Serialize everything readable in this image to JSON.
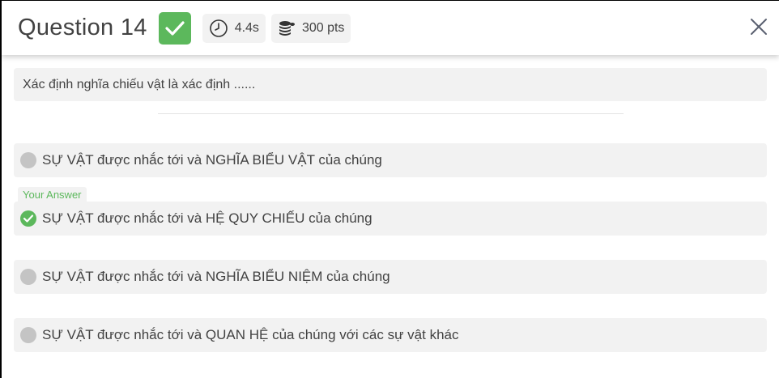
{
  "header": {
    "title": "Question 14",
    "time": "4.4s",
    "points": "300 pts",
    "status_icon": "check-icon",
    "time_icon": "clock-icon",
    "points_icon": "coins-icon",
    "close_icon": "close-icon"
  },
  "question": {
    "text": "Xác định nghĩa chiếu vật là xác định ......"
  },
  "answer_tag": "Your Answer",
  "options": [
    {
      "text": "SỰ VẬT được nhắc tới và NGHĨA BIỂU VẬT của chúng",
      "selected": false
    },
    {
      "text": "SỰ VẬT được nhắc tới và HỆ QUY CHIẾU của chúng",
      "selected": true
    },
    {
      "text": "SỰ VẬT được nhắc tới và NGHĨA BIỂU NIỆM của chúng",
      "selected": false
    },
    {
      "text": "SỰ VẬT được nhắc tới và QUAN HỆ của chúng với các sự vật khác",
      "selected": false
    }
  ],
  "colors": {
    "correct": "#5cb85c",
    "chip_bg": "#f2f2f2",
    "neutral_dot": "#c4c4c4",
    "text": "#424242"
  }
}
